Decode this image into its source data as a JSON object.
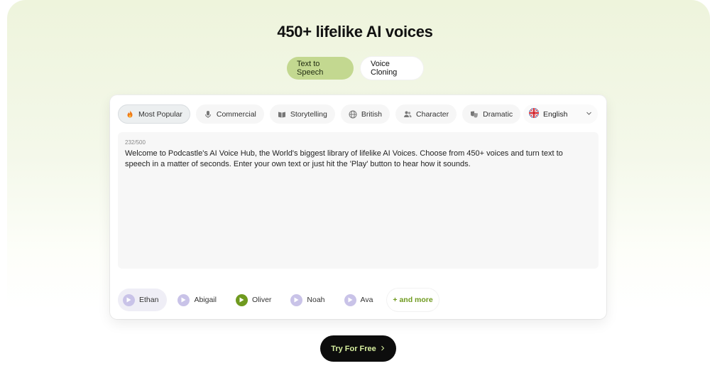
{
  "hero": {
    "title": "450+ lifelike AI voices"
  },
  "tabs": [
    {
      "label": "Text to Speech",
      "active": true
    },
    {
      "label": "Voice Cloning",
      "active": false
    }
  ],
  "categories": [
    {
      "label": "Most Popular",
      "icon": "fire-icon",
      "active": true
    },
    {
      "label": "Commercial",
      "icon": "microphone-icon",
      "active": false
    },
    {
      "label": "Storytelling",
      "icon": "book-icon",
      "active": false
    },
    {
      "label": "British",
      "icon": "globe-icon",
      "active": false
    },
    {
      "label": "Character",
      "icon": "users-icon",
      "active": false
    },
    {
      "label": "Dramatic",
      "icon": "theater-masks-icon",
      "active": false
    }
  ],
  "language": {
    "selected": "English",
    "icon": "uk-flag-icon"
  },
  "editor": {
    "counter": "232/500",
    "text": "Welcome to Podcastle's AI Voice Hub, the World's biggest library of lifelike AI Voices. Choose from 450+ voices and turn text to speech in a matter of seconds. Enter your own text or just hit the 'Play' button to hear how it sounds."
  },
  "voices": [
    {
      "name": "Ethan",
      "selected": true,
      "playing": false
    },
    {
      "name": "Abigail",
      "selected": false,
      "playing": false
    },
    {
      "name": "Oliver",
      "selected": false,
      "playing": true
    },
    {
      "name": "Noah",
      "selected": false,
      "playing": false
    },
    {
      "name": "Ava",
      "selected": false,
      "playing": false
    }
  ],
  "more_voices_label": "+ and more",
  "cta": {
    "label": "Try For Free",
    "icon": "chevron-right-icon"
  },
  "colors": {
    "accent_green": "#6f9a1f",
    "tab_active": "#c3d890",
    "cta_bg": "#0d0d0d",
    "play_purple": "#c9c3e8"
  }
}
